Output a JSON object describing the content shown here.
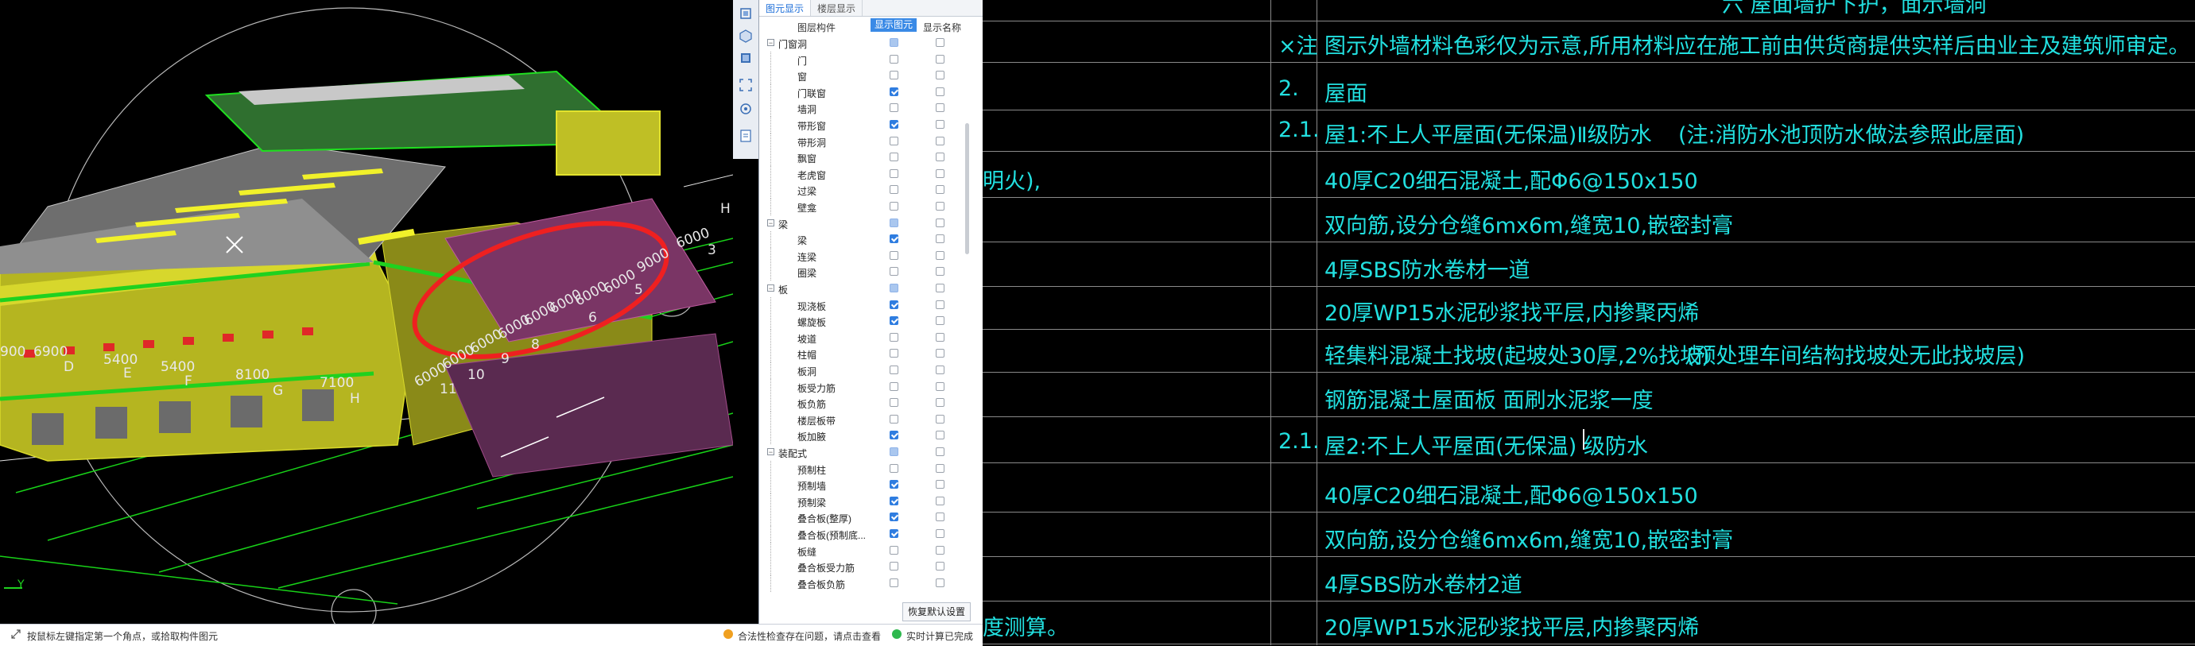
{
  "viewport": {
    "grid_labels": [
      "900",
      "6900",
      "D",
      "5400",
      "E",
      "5400",
      "F",
      "8100",
      "G",
      "7100",
      "H",
      "6000",
      "6000",
      "6000",
      "6000",
      "6000",
      "6000",
      "6000",
      "6000",
      "11",
      "10",
      "9",
      "8",
      "6",
      "5",
      "3",
      "H",
      "9000",
      "6000"
    ],
    "axis_label": "Y"
  },
  "toolstrip": {
    "icons": [
      "layers-icon",
      "cube-view-icon",
      "box-select-icon",
      "zoom-extents-icon",
      "orbit-icon",
      "report-icon"
    ]
  },
  "panel": {
    "tabs": [
      "图元显示",
      "楼层显示"
    ],
    "headers": {
      "component": "图层构件",
      "show_elem": "显示图元",
      "show_name": "显示名称"
    },
    "rows": [
      {
        "label": "门窗洞",
        "group": true,
        "elem": "part",
        "name": "off"
      },
      {
        "label": "门",
        "elem": "off",
        "name": "off"
      },
      {
        "label": "窗",
        "elem": "off",
        "name": "off"
      },
      {
        "label": "门联窗",
        "elem": "on",
        "name": "off"
      },
      {
        "label": "墙洞",
        "elem": "off",
        "name": "off"
      },
      {
        "label": "带形窗",
        "elem": "on",
        "name": "off"
      },
      {
        "label": "带形洞",
        "elem": "off",
        "name": "off"
      },
      {
        "label": "飘窗",
        "elem": "off",
        "name": "off"
      },
      {
        "label": "老虎窗",
        "elem": "off",
        "name": "off"
      },
      {
        "label": "过梁",
        "elem": "off",
        "name": "off"
      },
      {
        "label": "壁龛",
        "elem": "off",
        "name": "off"
      },
      {
        "label": "梁",
        "group": true,
        "elem": "part",
        "name": "off"
      },
      {
        "label": "梁",
        "elem": "on",
        "name": "off"
      },
      {
        "label": "连梁",
        "elem": "off",
        "name": "off"
      },
      {
        "label": "圈梁",
        "elem": "off",
        "name": "off"
      },
      {
        "label": "板",
        "group": true,
        "elem": "part",
        "name": "off"
      },
      {
        "label": "现浇板",
        "elem": "on",
        "name": "off"
      },
      {
        "label": "螺旋板",
        "elem": "on",
        "name": "off"
      },
      {
        "label": "坡道",
        "elem": "off",
        "name": "off"
      },
      {
        "label": "柱帽",
        "elem": "off",
        "name": "off"
      },
      {
        "label": "板洞",
        "elem": "off",
        "name": "off"
      },
      {
        "label": "板受力筋",
        "elem": "off",
        "name": "off"
      },
      {
        "label": "板负筋",
        "elem": "off",
        "name": "off"
      },
      {
        "label": "楼层板带",
        "elem": "off",
        "name": "off"
      },
      {
        "label": "板加腋",
        "elem": "on",
        "name": "off"
      },
      {
        "label": "装配式",
        "group": true,
        "elem": "part",
        "name": "off"
      },
      {
        "label": "预制柱",
        "elem": "off",
        "name": "off"
      },
      {
        "label": "预制墙",
        "elem": "on",
        "name": "off"
      },
      {
        "label": "预制梁",
        "elem": "on",
        "name": "off"
      },
      {
        "label": "叠合板(整厚)",
        "elem": "on",
        "name": "off"
      },
      {
        "label": "叠合板(预制底...",
        "elem": "on",
        "name": "off"
      },
      {
        "label": "板缝",
        "elem": "off",
        "name": "off"
      },
      {
        "label": "叠合板受力筋",
        "elem": "off",
        "name": "off"
      },
      {
        "label": "叠合板负筋",
        "elem": "off",
        "name": "off"
      }
    ],
    "restore_button": "恢复默认设置"
  },
  "statusbar": {
    "hint": "按鼠标左键指定第一个角点，或拾取构件图元",
    "warning": "合法性检查存在问题，请点击查看",
    "calc": "实时计算已完成"
  },
  "drawing": {
    "lines": [
      {
        "num": "",
        "text": "六  屋面墙护下护，面示墙洞"
      },
      {
        "num": "×注",
        "text": "图示外墙材料色彩仅为示意,所用材料应在施工前由供货商提供实样后由业主及建筑师审定。"
      },
      {
        "num": "2.",
        "text": "屋面"
      },
      {
        "num": "2.1.",
        "text": "屋1:不上人平屋面(无保温)Ⅱ级防水",
        "note": "(注:消防水池顶防水做法参照此屋面)"
      },
      {
        "num": "",
        "left": "明火),",
        "text": "40厚C20细石混凝土,配Φ6@150x150"
      },
      {
        "num": "",
        "text": "双向筋,设分仓缝6mx6m,缝宽10,嵌密封膏"
      },
      {
        "num": "",
        "text": "4厚SBS防水卷材一道"
      },
      {
        "num": "",
        "text": "20厚WP15水泥砂浆找平层,内掺聚丙烯"
      },
      {
        "num": "",
        "text": "轻集料混凝土找坡(起坡处30厚,2%找坡)",
        "note": "(预处理车间结构找坡处无此找坡层)"
      },
      {
        "num": "",
        "text": "钢筋混凝土屋面板 面刷水泥浆一度"
      },
      {
        "num": "2.1.",
        "text": "屋2:不上人平屋面(无保温)  级防水"
      },
      {
        "num": "",
        "text": "40厚C20细石混凝土,配Φ6@150x150"
      },
      {
        "num": "",
        "text": "双向筋,设分仓缝6mx6m,缝宽10,嵌密封膏"
      },
      {
        "num": "",
        "text": "4厚SBS防水卷材2道"
      },
      {
        "num": "",
        "left": "度测算。",
        "text": "20厚WP15水泥砂浆找平层,内掺聚丙烯"
      }
    ]
  }
}
